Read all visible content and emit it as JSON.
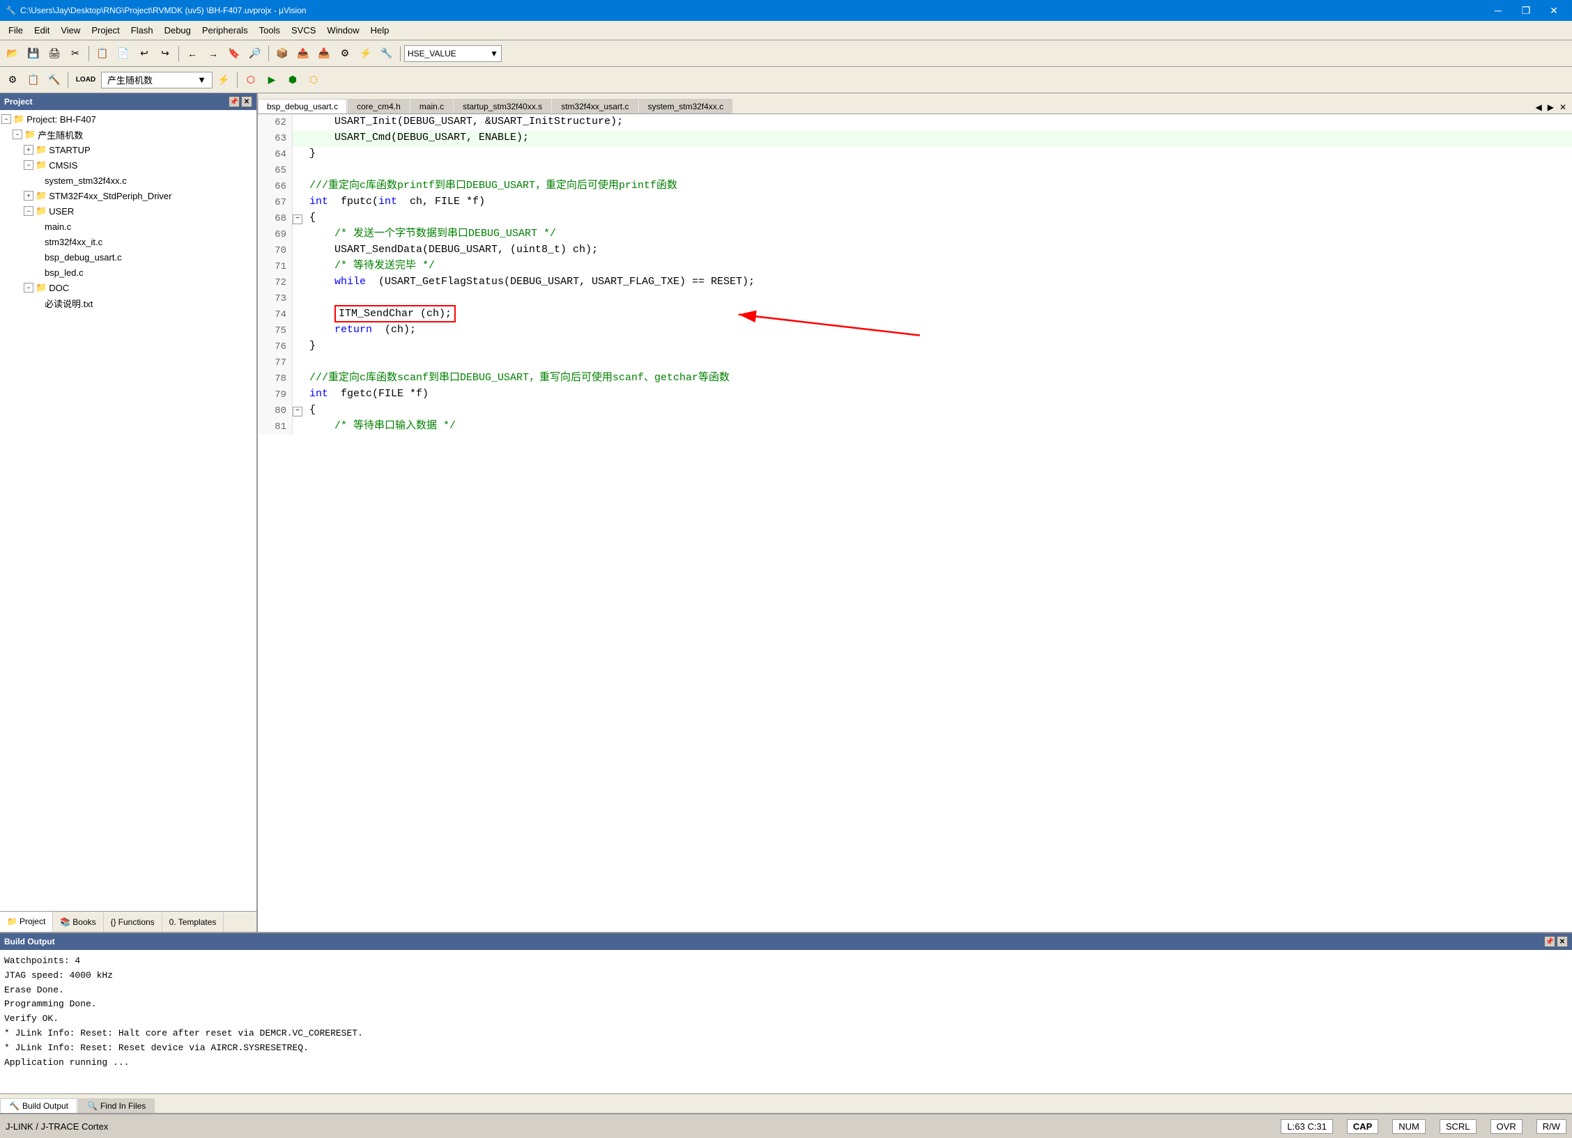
{
  "titleBar": {
    "title": "C:\\Users\\Jay\\Desktop\\RNG\\Project\\RVMDK (uv5) \\BH-F407.uvprojx - µVision",
    "minimize": "─",
    "restore": "❐",
    "close": "✕"
  },
  "menuBar": {
    "items": [
      "File",
      "Edit",
      "View",
      "Project",
      "Flash",
      "Debug",
      "Peripherals",
      "Tools",
      "SVCS",
      "Window",
      "Help"
    ]
  },
  "toolbar": {
    "dropdown": "HSE_VALUE"
  },
  "toolbar2": {
    "label": "产生随机数"
  },
  "projectPanel": {
    "title": "Project",
    "tree": [
      {
        "level": 1,
        "type": "expand",
        "icon": "expand",
        "label": "Project: BH-F407",
        "expand": "−"
      },
      {
        "level": 2,
        "type": "expand",
        "icon": "folder",
        "label": "产生随机数",
        "expand": "−"
      },
      {
        "level": 3,
        "type": "expand",
        "icon": "folder",
        "label": "STARTUP",
        "expand": "+"
      },
      {
        "level": 3,
        "type": "expand",
        "icon": "folder",
        "label": "CMSIS",
        "expand": "−"
      },
      {
        "level": 4,
        "type": "file",
        "icon": "file-c",
        "label": "system_stm32f4xx.c"
      },
      {
        "level": 3,
        "type": "expand",
        "icon": "folder",
        "label": "STM32F4xx_StdPeriph_Driver",
        "expand": "+"
      },
      {
        "level": 3,
        "type": "expand",
        "icon": "folder",
        "label": "USER",
        "expand": "−"
      },
      {
        "level": 4,
        "type": "file",
        "icon": "file-c",
        "label": "main.c"
      },
      {
        "level": 4,
        "type": "file",
        "icon": "file-c",
        "label": "stm32f4xx_it.c"
      },
      {
        "level": 4,
        "type": "file",
        "icon": "file-c",
        "label": "bsp_debug_usart.c"
      },
      {
        "level": 4,
        "type": "file",
        "icon": "file-c",
        "label": "bsp_led.c"
      },
      {
        "level": 3,
        "type": "expand",
        "icon": "folder",
        "label": "DOC",
        "expand": "−"
      },
      {
        "level": 4,
        "type": "file",
        "icon": "file-txt",
        "label": "必读说明.txt"
      }
    ],
    "tabs": [
      "Project",
      "Books",
      "Functions",
      "Templates"
    ]
  },
  "editorTabs": [
    {
      "label": "bsp_debug_usart.c",
      "active": true
    },
    {
      "label": "core_cm4.h",
      "active": false
    },
    {
      "label": "main.c",
      "active": false
    },
    {
      "label": "startup_stm32f40xx.s",
      "active": false
    },
    {
      "label": "stm32f4xx_usart.c",
      "active": false
    },
    {
      "label": "system_stm32f4xx.c",
      "active": false
    }
  ],
  "codeLines": [
    {
      "num": 62,
      "content": "    USART_Init(DEBUG_USART, &USART_InitStructure);",
      "bg": "white"
    },
    {
      "num": 63,
      "content": "    USART_Cmd(DEBUG_USART, ENABLE);",
      "bg": "#efffef"
    },
    {
      "num": 64,
      "content": "}",
      "bg": "white"
    },
    {
      "num": 65,
      "content": "",
      "bg": "white"
    },
    {
      "num": 66,
      "content": "///重定向c库函数printf到串口DEBUG_USART，重定向后可使用printf函数",
      "bg": "white"
    },
    {
      "num": 67,
      "content": "int fputc(int ch, FILE *f)",
      "bg": "white"
    },
    {
      "num": 68,
      "content": "{",
      "bg": "white",
      "expand": true
    },
    {
      "num": 69,
      "content": "    /* 发送一个字节数据到串口DEBUG_USART */",
      "bg": "white"
    },
    {
      "num": 70,
      "content": "    USART_SendData(DEBUG_USART, (uint8_t) ch);",
      "bg": "white"
    },
    {
      "num": 71,
      "content": "    /* 等待发送完毕 */",
      "bg": "white"
    },
    {
      "num": 72,
      "content": "    while (USART_GetFlagStatus(DEBUG_USART, USART_FLAG_TXE) == RESET);",
      "bg": "white"
    },
    {
      "num": 73,
      "content": "",
      "bg": "white"
    },
    {
      "num": 74,
      "content": "    ITM_SendChar (ch);",
      "bg": "white",
      "highlight": true
    },
    {
      "num": 75,
      "content": "    return (ch);",
      "bg": "white"
    },
    {
      "num": 76,
      "content": "}",
      "bg": "white"
    },
    {
      "num": 77,
      "content": "",
      "bg": "white"
    },
    {
      "num": 78,
      "content": "///重定向c库函数scanf到串口DEBUG_USART，重写向后可使用scanf、getchar等函数",
      "bg": "white"
    },
    {
      "num": 79,
      "content": "int fgetc(FILE *f)",
      "bg": "white"
    },
    {
      "num": 80,
      "content": "{",
      "bg": "white",
      "expand": true
    },
    {
      "num": 81,
      "content": "    /* 等待串口输入数据 */",
      "bg": "white"
    }
  ],
  "redBoxLine": 74,
  "buildOutput": {
    "title": "Build Output",
    "content": [
      "Watchpoints:         4",
      "JTAG speed: 4000 kHz",
      "",
      "Erase Done.",
      "Programming Done.",
      "Verify OK.",
      "* JLink Info: Reset: Halt core after reset via DEMCR.VC_CORERESET.",
      "* JLink Info: Reset: Reset device via AIRCR.SYSRESETREQ.",
      "Application running ..."
    ],
    "tabs": [
      "Build Output",
      "Find In Files"
    ]
  },
  "statusBar": {
    "connection": "J-LINK / J-TRACE Cortex",
    "position": "L:63 C:31",
    "cap": "CAP",
    "num": "NUM",
    "scrl": "SCRL",
    "ovr": "OVR",
    "rw": "R/W"
  }
}
